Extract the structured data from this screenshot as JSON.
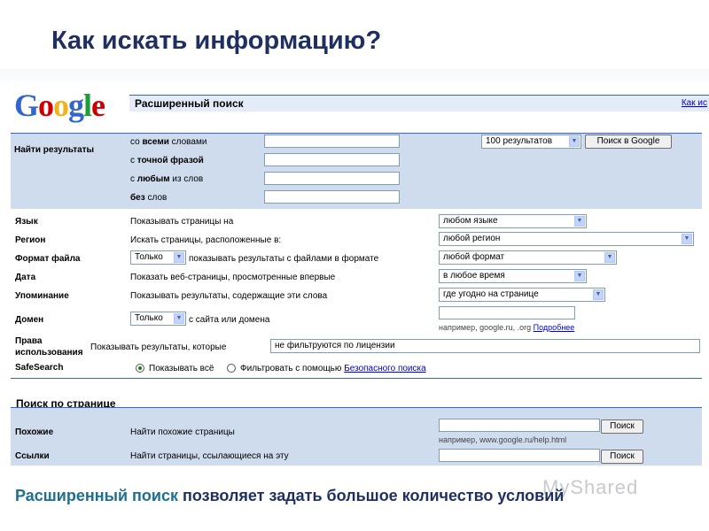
{
  "slide": {
    "title": "Как искать информацию?",
    "bottom_highlight": "Расширенный поиск",
    "bottom_rest": " позволяет задать большое количество условий",
    "watermark": "MyShared"
  },
  "google": {
    "logo": [
      "G",
      "o",
      "o",
      "g",
      "l",
      "e"
    ],
    "logo_colors": [
      "#3366cc",
      "#cc0000",
      "#f2b21a",
      "#3366cc",
      "#1e9e36",
      "#cc0000"
    ],
    "title": "Расширенный поиск",
    "top_link": "Как ис"
  },
  "find": {
    "label": "Найти результаты",
    "rows": [
      {
        "prefix": "со ",
        "bold": "всеми",
        "suffix": " словами"
      },
      {
        "prefix": "с ",
        "bold": "точной фразой",
        "suffix": ""
      },
      {
        "prefix": "с ",
        "bold": "любым",
        "suffix": " из слов"
      },
      {
        "prefix": "",
        "bold": "без",
        "suffix": " слов"
      }
    ],
    "results_select": "100 результатов",
    "search_button": "Поиск в Google"
  },
  "filters": {
    "language": {
      "label": "Язык",
      "desc": "Показывать страницы на",
      "value": "любом языке"
    },
    "region": {
      "label": "Регион",
      "desc": "Искать страницы, расположенные в:",
      "value": "любой регион"
    },
    "format": {
      "label": "Формат файла",
      "mode": "Только",
      "desc": "показывать результаты с файлами в формате",
      "value": "любой формат"
    },
    "date": {
      "label": "Дата",
      "desc": "Показать веб-страницы, просмотренные впервые",
      "value": "в любое время"
    },
    "occurrence": {
      "label": "Упоминание",
      "desc": "Показывать результаты, содержащие эти слова",
      "value": "где угодно на странице"
    },
    "domain": {
      "label": "Домен",
      "mode": "Только",
      "desc": "с сайта или домена",
      "hint": "например, google.ru, .org",
      "hint_link": "Подробнее"
    },
    "rights": {
      "label1": "Права",
      "label2": "использования",
      "desc": "Показывать результаты, которые",
      "value": "не фильтруются по лицензии"
    },
    "safesearch": {
      "label": "SafeSearch",
      "opt1": "Показывать всё",
      "opt2": "Фильтровать с помощью",
      "opt2_link": "Безопасного поиска"
    }
  },
  "page_search": {
    "title": "Поиск по странице",
    "similar": {
      "label": "Похожие",
      "desc": "Найти похожие страницы",
      "button": "Поиск",
      "hint": "например, www.google.ru/help.html"
    },
    "links": {
      "label": "Ссылки",
      "desc": "Найти страницы, ссылающиеся на эту",
      "button": "Поиск"
    }
  }
}
